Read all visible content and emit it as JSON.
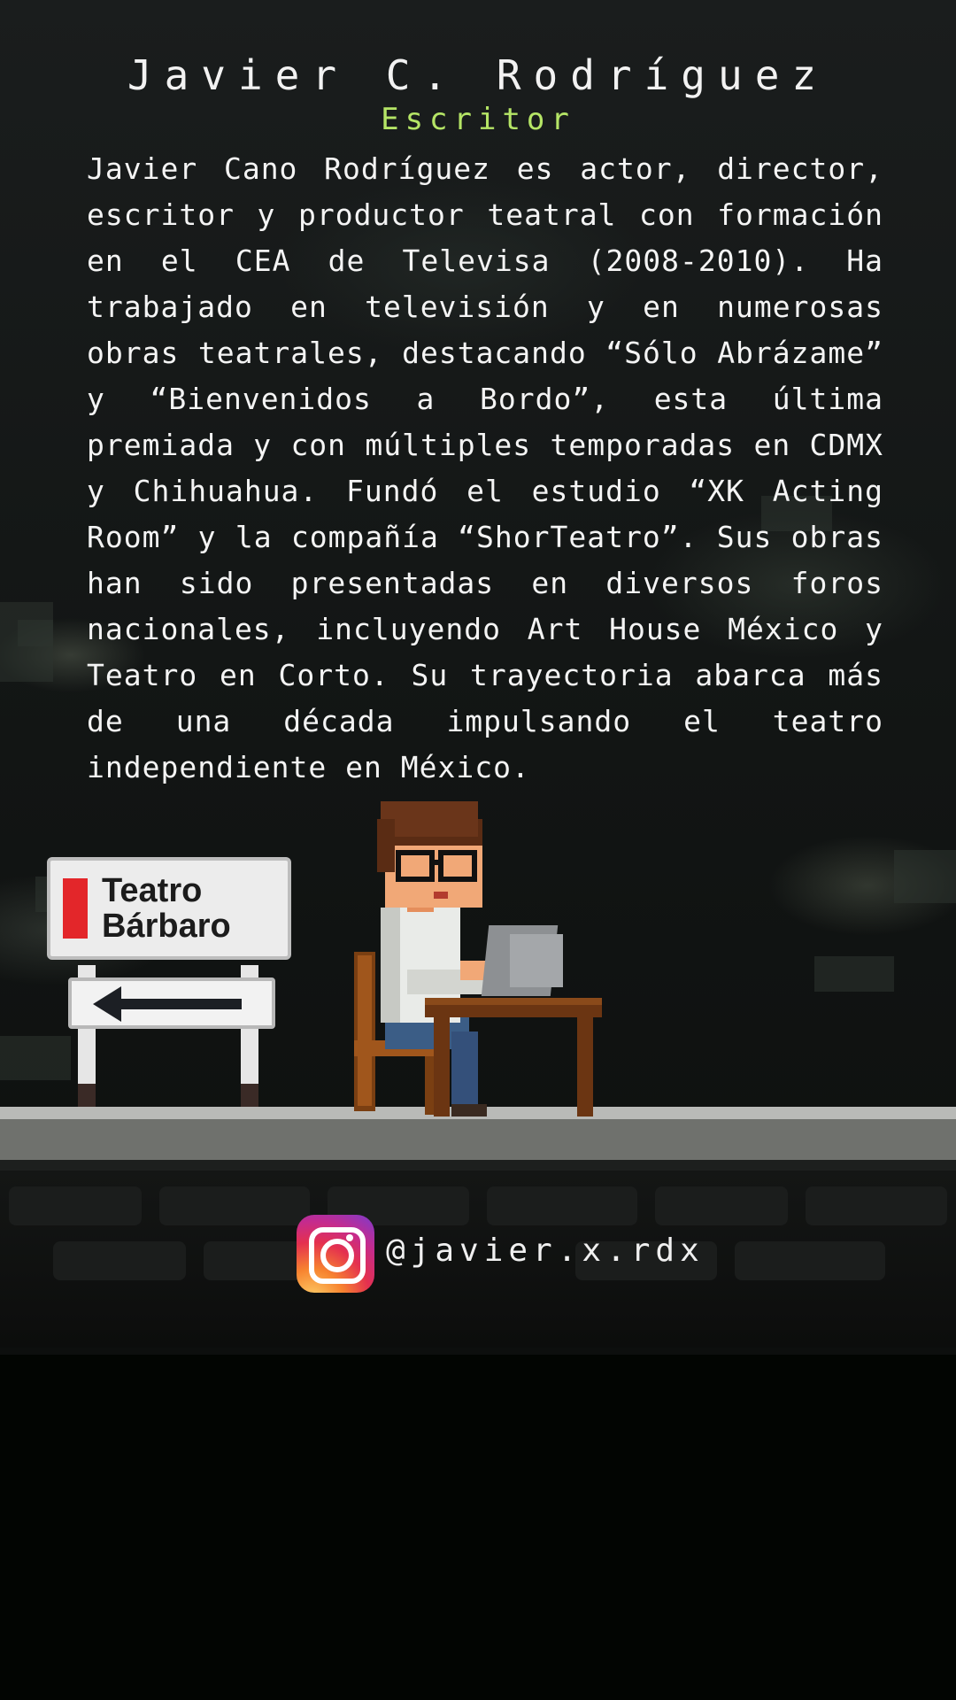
{
  "profile": {
    "name": "Javier C. Rodríguez",
    "role": "Escritor",
    "bio": "Javier Cano Rodríguez es actor, director, escritor y productor teatral con formación en el CEA de Televisa (2008-2010). Ha trabajado en televisión y en numerosas obras teatrales, destacando “Sólo Abrázame” y “Bienvenidos a Bordo”, esta última premiada y con múltiples temporadas en CDMX y Chihuahua. Fundó el estudio “XK Acting Room” y la compañía “ShorTeatro”. Sus obras han sido presentadas en diversos foros nacionales, incluyendo Art House México y Teatro en Corto. Su trayectoria abarca más de una década impulsando el teatro independiente en México."
  },
  "sign": {
    "line1": "Teatro",
    "line2": "Bárbaro",
    "arrow_icon": "arrow-left-icon"
  },
  "social": {
    "icon": "instagram-icon",
    "handle": "@javier.x.rdx"
  },
  "colors": {
    "accent": "#b5e566",
    "text": "#f2f2f2",
    "logo_red": "#e3262a",
    "background": "#020502"
  }
}
